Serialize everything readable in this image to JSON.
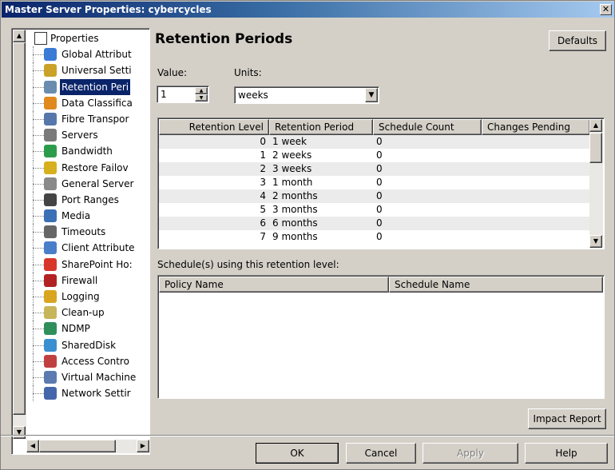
{
  "window": {
    "title": "Master Server Properties: cybercycles",
    "close_glyph": "✕"
  },
  "tree": {
    "root_label": "Properties",
    "items": [
      {
        "label": "Global Attribut",
        "icon": "globe-icon",
        "color": "#3a7bd5"
      },
      {
        "label": "Universal Setti",
        "icon": "settings-icon",
        "color": "#c9a227"
      },
      {
        "label": "Retention Peri",
        "icon": "retention-icon",
        "color": "#6a8caf",
        "selected": true
      },
      {
        "label": "Data Classifica",
        "icon": "classification-icon",
        "color": "#e08a1e"
      },
      {
        "label": "Fibre Transpor",
        "icon": "fibre-transport-icon",
        "color": "#5577aa"
      },
      {
        "label": "Servers",
        "icon": "servers-icon",
        "color": "#7a7a7a"
      },
      {
        "label": "Bandwidth",
        "icon": "bandwidth-icon",
        "color": "#2d9c4a"
      },
      {
        "label": "Restore Failov",
        "icon": "restore-failover-icon",
        "color": "#d6b01e"
      },
      {
        "label": "General Server",
        "icon": "general-server-icon",
        "color": "#8a8a8a"
      },
      {
        "label": "Port Ranges",
        "icon": "port-ranges-icon",
        "color": "#444444"
      },
      {
        "label": "Media",
        "icon": "media-icon",
        "color": "#3b6fb6"
      },
      {
        "label": "Timeouts",
        "icon": "timeouts-icon",
        "color": "#666666"
      },
      {
        "label": "Client Attribute",
        "icon": "client-attributes-icon",
        "color": "#4a7ec9"
      },
      {
        "label": "SharePoint Ho:",
        "icon": "sharepoint-icon",
        "color": "#d8352a"
      },
      {
        "label": "Firewall",
        "icon": "firewall-icon",
        "color": "#b22222"
      },
      {
        "label": "Logging",
        "icon": "logging-icon",
        "color": "#d9a520"
      },
      {
        "label": "Clean-up",
        "icon": "cleanup-icon",
        "color": "#c7b55a"
      },
      {
        "label": "NDMP",
        "icon": "ndmp-icon",
        "color": "#2f8f5b"
      },
      {
        "label": "SharedDisk",
        "icon": "shareddisk-icon",
        "color": "#3a8fd0"
      },
      {
        "label": "Access Contro",
        "icon": "access-control-icon",
        "color": "#c04040"
      },
      {
        "label": "Virtual Machine",
        "icon": "virtual-machine-icon",
        "color": "#5a7ab0"
      },
      {
        "label": "Network Settir",
        "icon": "network-settings-icon",
        "color": "#4466aa"
      }
    ]
  },
  "main": {
    "heading": "Retention Periods",
    "defaults_button": "Defaults",
    "value_label": "Value:",
    "value": "1",
    "units_label": "Units:",
    "units_value": "weeks",
    "table": {
      "columns": [
        "Retention Level",
        "Retention Period",
        "Schedule Count",
        "Changes Pending"
      ],
      "rows": [
        [
          "0",
          "1 week",
          "0",
          ""
        ],
        [
          "1",
          "2 weeks",
          "0",
          ""
        ],
        [
          "2",
          "3 weeks",
          "0",
          ""
        ],
        [
          "3",
          "1 month",
          "0",
          ""
        ],
        [
          "4",
          "2 months",
          "0",
          ""
        ],
        [
          "5",
          "3 months",
          "0",
          ""
        ],
        [
          "6",
          "6 months",
          "0",
          ""
        ],
        [
          "7",
          "9 months",
          "0",
          ""
        ]
      ]
    },
    "schedules_label": "Schedule(s) using this retention level:",
    "schedules_table": {
      "columns": [
        "Policy Name",
        "Schedule Name"
      ]
    },
    "impact_report_button": "Impact Report"
  },
  "footer": {
    "ok": "OK",
    "cancel": "Cancel",
    "apply": "Apply",
    "help": "Help"
  },
  "scroll_glyphs": {
    "up": "▲",
    "down": "▼",
    "left": "◀",
    "right": "▶"
  }
}
